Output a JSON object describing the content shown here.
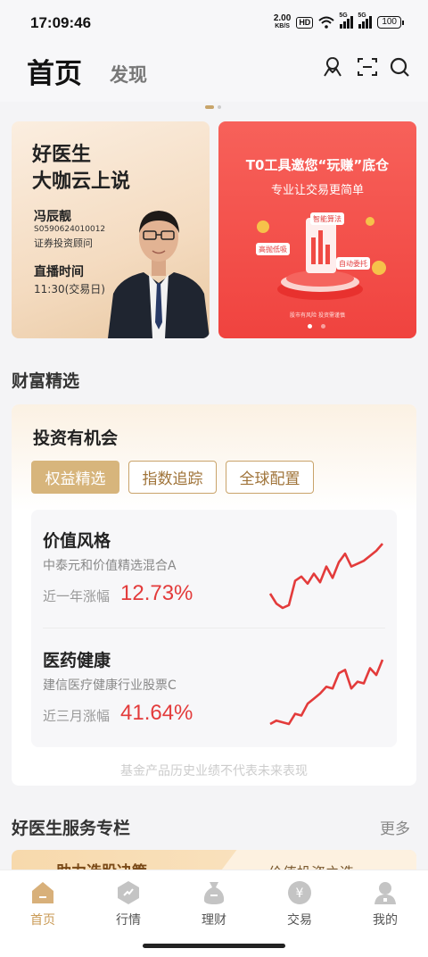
{
  "status_bar": {
    "time": "17:09:46",
    "speed_value": "2.00",
    "speed_unit": "KB/S",
    "hd": "HD",
    "net1": "5G",
    "net2": "5G",
    "battery": "100"
  },
  "header": {
    "tab_home": "首页",
    "tab_discover": "发现"
  },
  "banners": {
    "banner1": {
      "title_line1": "好医生",
      "title_line2": "大咖云上说",
      "name": "冯辰靓",
      "code": "S0590624010012",
      "role": "证券投资顾问",
      "live_label": "直播时间",
      "live_time": "11:30(交易日)"
    },
    "banner2": {
      "title": "T0工具邀您“玩赚”底仓",
      "subtitle": "专业让交易更简单",
      "tag1": "智能算法",
      "tag2": "高抛低吸",
      "tag3": "自动委托",
      "footer": "股市有风险 投资需谨慎"
    }
  },
  "wealth": {
    "section_title": "财富精选",
    "card_title": "投资有机会",
    "tabs": [
      "权益精选",
      "指数追踪",
      "全球配置"
    ],
    "funds": [
      {
        "category": "价值风格",
        "fund_name": "中泰元和价值精选混合A",
        "return_label": "近一年涨幅",
        "return_value": "12.73%",
        "trend": [
          42,
          28,
          22,
          26,
          60,
          66,
          56,
          70,
          58,
          80,
          64,
          86,
          98,
          80,
          84,
          88,
          95,
          102,
          112
        ]
      },
      {
        "category": "医药健康",
        "fund_name": "建信医疗健康行业股票C",
        "return_label": "近三月涨幅",
        "return_value": "41.64%",
        "trend": [
          20,
          24,
          22,
          20,
          32,
          30,
          44,
          50,
          56,
          64,
          62,
          80,
          84,
          62,
          70,
          68,
          86,
          78,
          96
        ]
      }
    ],
    "disclaimer": "基金产品历史业绩不代表未来表现"
  },
  "service": {
    "section_title": "好医生服务专栏",
    "more": "更多",
    "card_left": "助力选股决策",
    "card_right": "价值投资之选"
  },
  "tabbar": {
    "items": [
      "首页",
      "行情",
      "理财",
      "交易",
      "我的"
    ],
    "active_index": 0
  },
  "colors": {
    "accent": "#c99a55",
    "red": "#e33b3b",
    "banner_red": "#f04a44"
  }
}
